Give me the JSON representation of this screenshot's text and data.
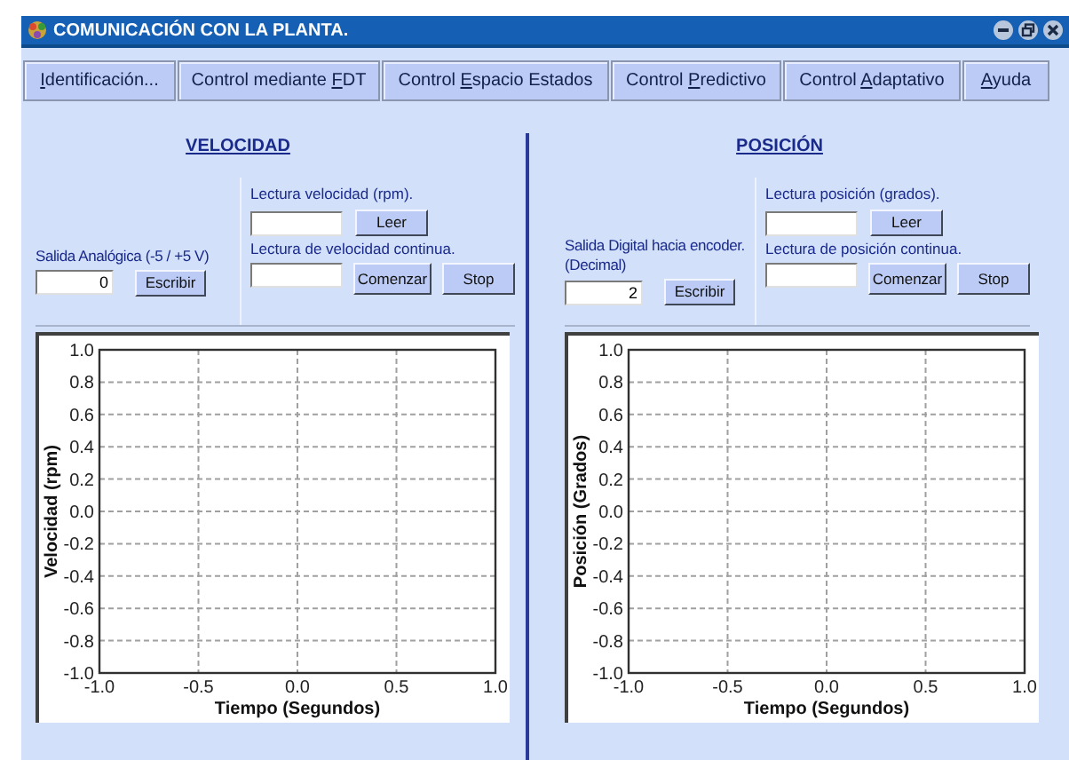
{
  "window": {
    "title": "COMUNICACIÓN CON LA PLANTA."
  },
  "tabs": [
    {
      "key": "I",
      "post": "dentificación..."
    },
    {
      "pre": "Control mediante ",
      "key": "F",
      "post": "DT"
    },
    {
      "pre": "Control ",
      "key": "E",
      "post": "spacio Estados"
    },
    {
      "pre": "Control ",
      "key": "P",
      "post": "redictivo"
    },
    {
      "pre": "Control ",
      "key": "A",
      "post": "daptativo"
    },
    {
      "key": "A",
      "post": "yuda"
    }
  ],
  "panels": [
    {
      "heading": "VELOCIDAD",
      "output_label": "Salida Analógica (-5 / +5 V)",
      "output_value": "0",
      "write_button": "Escribir",
      "read_label": "Lectura velocidad (rpm).",
      "read_button": "Leer",
      "continuous_label": "Lectura de velocidad continua.",
      "start_button": "Comenzar",
      "stop_button": "Stop",
      "chart_data": {
        "type": "line",
        "grid": true,
        "xlabel": "Tiempo (Segundos)",
        "ylabel": "Velocidad (rpm)",
        "xlim": [
          -1,
          1
        ],
        "ylim": [
          -1,
          1
        ],
        "xticks": [
          {
            "value": -1,
            "label": "-1.0"
          },
          {
            "value": -0.5,
            "label": "-0.5"
          },
          {
            "value": 0,
            "label": "0.0"
          },
          {
            "value": 0.5,
            "label": "0.5"
          },
          {
            "value": 1,
            "label": "1.0"
          }
        ],
        "yticks": [
          {
            "value": 1,
            "label": "1.0"
          },
          {
            "value": 0.8,
            "label": "0.8"
          },
          {
            "value": 0.6,
            "label": "0.6"
          },
          {
            "value": 0.4,
            "label": "0.4"
          },
          {
            "value": 0.2,
            "label": "0.2"
          },
          {
            "value": 0,
            "label": "0.0"
          },
          {
            "value": -0.2,
            "label": "-0.2"
          },
          {
            "value": -0.4,
            "label": "-0.4"
          },
          {
            "value": -0.6,
            "label": "-0.6"
          },
          {
            "value": -0.8,
            "label": "-0.8"
          },
          {
            "value": -1,
            "label": "-1.0"
          }
        ]
      }
    },
    {
      "heading": "POSICIÓN",
      "output_label": "Salida Digital hacia encoder. (Decimal)",
      "output_value": "2",
      "write_button": "Escribir",
      "read_label": "Lectura posición (grados).",
      "read_button": "Leer",
      "continuous_label": "Lectura de posición continua.",
      "start_button": "Comenzar",
      "stop_button": "Stop",
      "chart_data": {
        "type": "line",
        "grid": true,
        "xlabel": "Tiempo (Segundos)",
        "ylabel": "Posición (Grados)",
        "xlim": [
          -1,
          1
        ],
        "ylim": [
          -1,
          1
        ],
        "xticks": [
          {
            "value": -1,
            "label": "-1.0"
          },
          {
            "value": -0.5,
            "label": "-0.5"
          },
          {
            "value": 0,
            "label": "0.0"
          },
          {
            "value": 0.5,
            "label": "0.5"
          },
          {
            "value": 1,
            "label": "1.0"
          }
        ],
        "yticks": [
          {
            "value": 1,
            "label": "1.0"
          },
          {
            "value": 0.8,
            "label": "0.8"
          },
          {
            "value": 0.6,
            "label": "0.6"
          },
          {
            "value": 0.4,
            "label": "0.4"
          },
          {
            "value": 0.2,
            "label": "0.2"
          },
          {
            "value": 0,
            "label": "0.0"
          },
          {
            "value": -0.2,
            "label": "-0.2"
          },
          {
            "value": -0.4,
            "label": "-0.4"
          },
          {
            "value": -0.6,
            "label": "-0.6"
          },
          {
            "value": -0.8,
            "label": "-0.8"
          },
          {
            "value": -1,
            "label": "-1.0"
          }
        ]
      }
    }
  ]
}
